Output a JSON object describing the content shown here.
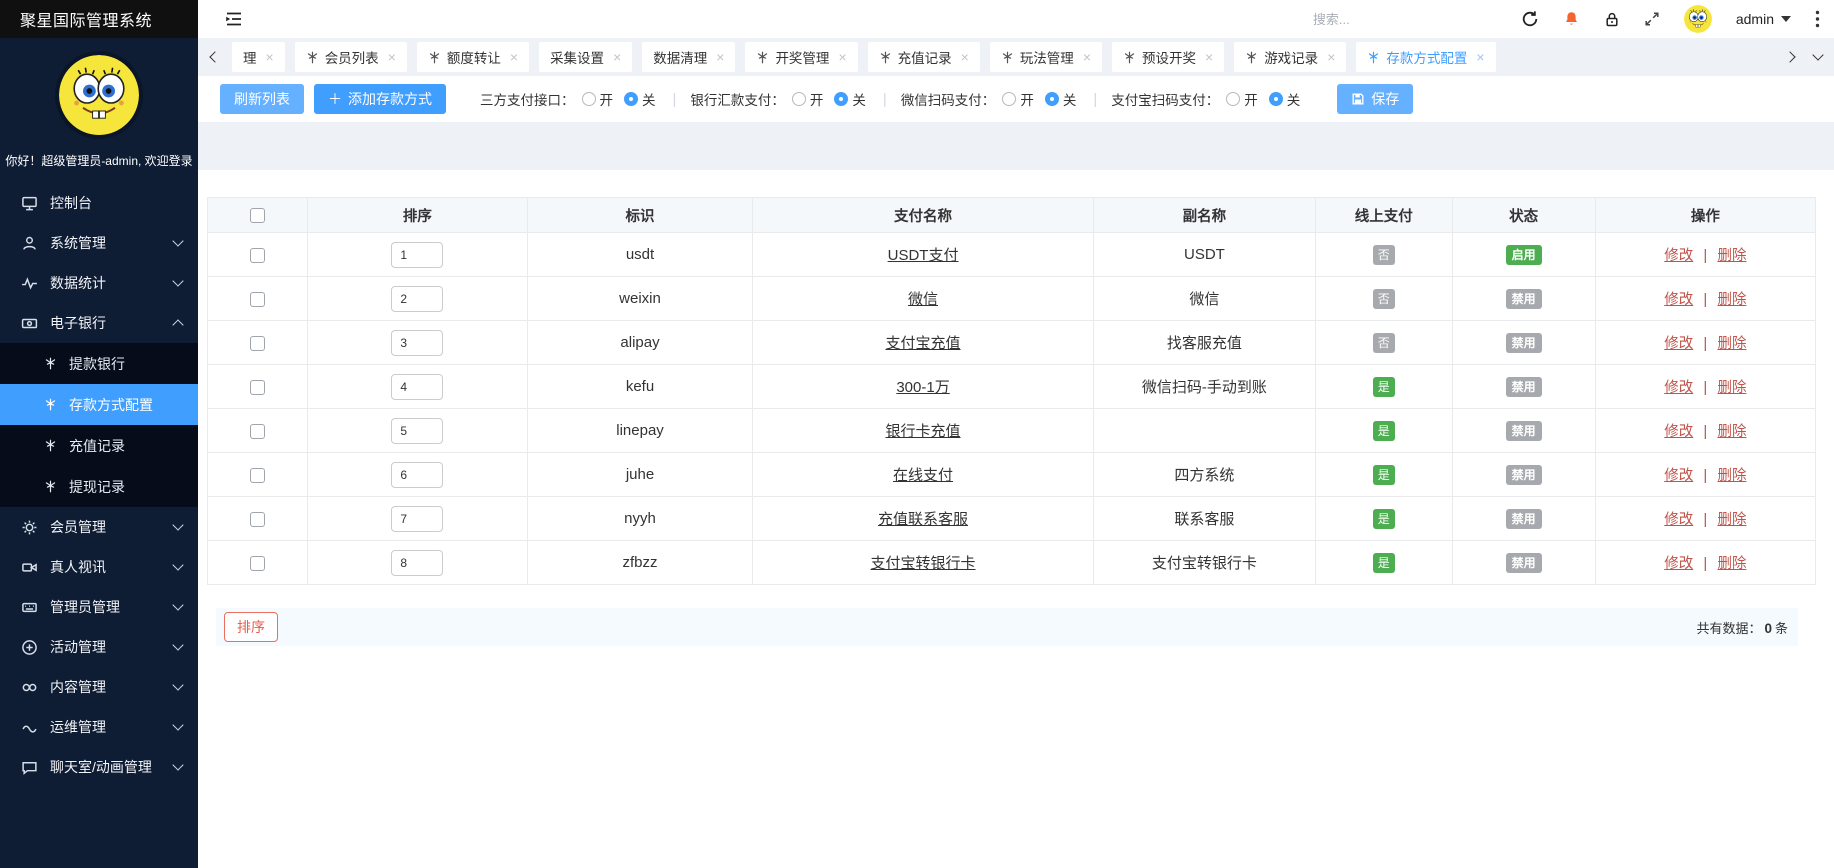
{
  "app": {
    "title": "聚星国际管理系统",
    "search_placeholder": "搜索...",
    "user": "admin"
  },
  "icons": {
    "close": "×",
    "sep": "|"
  },
  "sidebar": {
    "welcome": "你好！超级管理员-admin, 欢迎登录",
    "items": [
      {
        "label": "控制台",
        "icon": "console",
        "expandable": false
      },
      {
        "label": "系统管理",
        "icon": "user",
        "expandable": true
      },
      {
        "label": "数据统计",
        "icon": "stats",
        "expandable": true
      },
      {
        "label": "电子银行",
        "icon": "bank",
        "expandable": true,
        "expanded": true,
        "children": [
          {
            "label": "提款银行",
            "active": false
          },
          {
            "label": "存款方式配置",
            "active": true
          },
          {
            "label": "充值记录",
            "active": false
          },
          {
            "label": "提现记录",
            "active": false
          }
        ]
      },
      {
        "label": "会员管理",
        "icon": "gear",
        "expandable": true
      },
      {
        "label": "真人视讯",
        "icon": "video",
        "expandable": true
      },
      {
        "label": "管理员管理",
        "icon": "keyboard",
        "expandable": true
      },
      {
        "label": "活动管理",
        "icon": "plus-circle",
        "expandable": true
      },
      {
        "label": "内容管理",
        "icon": "content",
        "expandable": true
      },
      {
        "label": "运维管理",
        "icon": "ops",
        "expandable": true
      },
      {
        "label": "聊天室/动画管理",
        "icon": "chat",
        "expandable": true
      }
    ]
  },
  "tabs": [
    {
      "label": "理",
      "icon": false,
      "active": false
    },
    {
      "label": "会员列表",
      "icon": true,
      "active": false
    },
    {
      "label": "额度转让",
      "icon": true,
      "active": false
    },
    {
      "label": "采集设置",
      "icon": false,
      "active": false
    },
    {
      "label": "数据清理",
      "icon": false,
      "active": false
    },
    {
      "label": "开奖管理",
      "icon": true,
      "active": false
    },
    {
      "label": "充值记录",
      "icon": true,
      "active": false
    },
    {
      "label": "玩法管理",
      "icon": true,
      "active": false
    },
    {
      "label": "预设开奖",
      "icon": true,
      "active": false
    },
    {
      "label": "游戏记录",
      "icon": true,
      "active": false
    },
    {
      "label": "存款方式配置",
      "icon": true,
      "active": true
    }
  ],
  "toolbar": {
    "refresh_label": "刷新列表",
    "add_label": "添加存款方式",
    "save_label": "保存",
    "switches": [
      {
        "label": "三方支付接口：",
        "options": [
          {
            "text": "开",
            "selected": false
          },
          {
            "text": "关",
            "selected": true
          }
        ]
      },
      {
        "label": "银行汇款支付：",
        "options": [
          {
            "text": "开",
            "selected": false
          },
          {
            "text": "关",
            "selected": true
          }
        ]
      },
      {
        "label": "微信扫码支付：",
        "options": [
          {
            "text": "开",
            "selected": false
          },
          {
            "text": "关",
            "selected": true
          }
        ]
      },
      {
        "label": "支付宝扫码支付：",
        "options": [
          {
            "text": "开",
            "selected": false
          },
          {
            "text": "关",
            "selected": true
          }
        ]
      }
    ]
  },
  "table": {
    "headers": [
      "排序",
      "标识",
      "支付名称",
      "副名称",
      "线上支付",
      "状态",
      "操作"
    ],
    "edit_label": "修改",
    "delete_label": "删除",
    "rows": [
      {
        "sort": "1",
        "code": "usdt",
        "name": "USDT支付",
        "subname": "USDT",
        "online": "否",
        "status": "启用"
      },
      {
        "sort": "2",
        "code": "weixin",
        "name": "微信",
        "subname": "微信",
        "online": "否",
        "status": "禁用"
      },
      {
        "sort": "3",
        "code": "alipay",
        "name": "支付宝充值",
        "subname": "找客服充值",
        "online": "否",
        "status": "禁用"
      },
      {
        "sort": "4",
        "code": "kefu",
        "name": "300-1万",
        "subname": "微信扫码-手动到账",
        "online": "是",
        "status": "禁用"
      },
      {
        "sort": "5",
        "code": "linepay",
        "name": "银行卡充值",
        "subname": "",
        "online": "是",
        "status": "禁用"
      },
      {
        "sort": "6",
        "code": "juhe",
        "name": "在线支付",
        "subname": "四方系统",
        "online": "是",
        "status": "禁用"
      },
      {
        "sort": "7",
        "code": "nyyh",
        "name": "充值联系客服",
        "subname": "联系客服",
        "online": "是",
        "status": "禁用"
      },
      {
        "sort": "8",
        "code": "zfbzz",
        "name": "支付宝转银行卡",
        "subname": "支付宝转银行卡",
        "online": "是",
        "status": "禁用"
      }
    ]
  },
  "footer": {
    "sort_button": "排序",
    "total_prefix": "共有数据：",
    "total_count": "0",
    "total_suffix": "条"
  },
  "colors": {
    "accent_blue": "#409eff",
    "badge_green": "#4cae50",
    "badge_gray": "#a6a9ad",
    "danger_red": "#e95d4e",
    "sidebar_navy": "#0e1c34"
  }
}
